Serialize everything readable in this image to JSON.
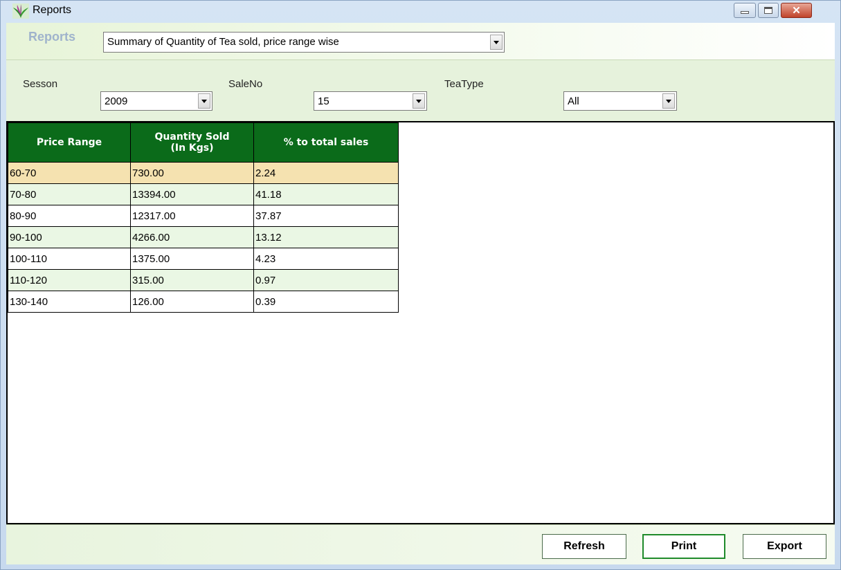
{
  "window": {
    "title": "Reports"
  },
  "reports_bar": {
    "label": "Reports",
    "selected_report": "Summary of Quantity of Tea sold, price range wise"
  },
  "filters": {
    "season_label": "Sesson",
    "season_value": "2009",
    "saleno_label": "SaleNo",
    "saleno_value": "15",
    "teatype_label": "TeaType",
    "teatype_value": "All"
  },
  "grid": {
    "headers": [
      "Price Range",
      "Quantity Sold\n(In Kgs)",
      "% to total sales"
    ],
    "header_1": "Price Range",
    "header_2_line1": "Quantity Sold",
    "header_2_line2": "(In Kgs)",
    "header_3": "% to total sales",
    "rows": [
      {
        "range": "60-70",
        "qty": "730.00",
        "pct": "2.24"
      },
      {
        "range": "70-80",
        "qty": "13394.00",
        "pct": "41.18"
      },
      {
        "range": "80-90",
        "qty": "12317.00",
        "pct": "37.87"
      },
      {
        "range": "90-100",
        "qty": "4266.00",
        "pct": "13.12"
      },
      {
        "range": "100-110",
        "qty": "1375.00",
        "pct": "4.23"
      },
      {
        "range": "110-120",
        "qty": "315.00",
        "pct": "0.97"
      },
      {
        "range": "130-140",
        "qty": "126.00",
        "pct": "0.39"
      }
    ]
  },
  "actions": {
    "refresh": "Refresh",
    "print": "Print",
    "export": "Export"
  },
  "colors": {
    "header_bg": "#0b6b1a",
    "selected_row": "#f5e2b0",
    "alt_row": "#eaf7e4"
  }
}
